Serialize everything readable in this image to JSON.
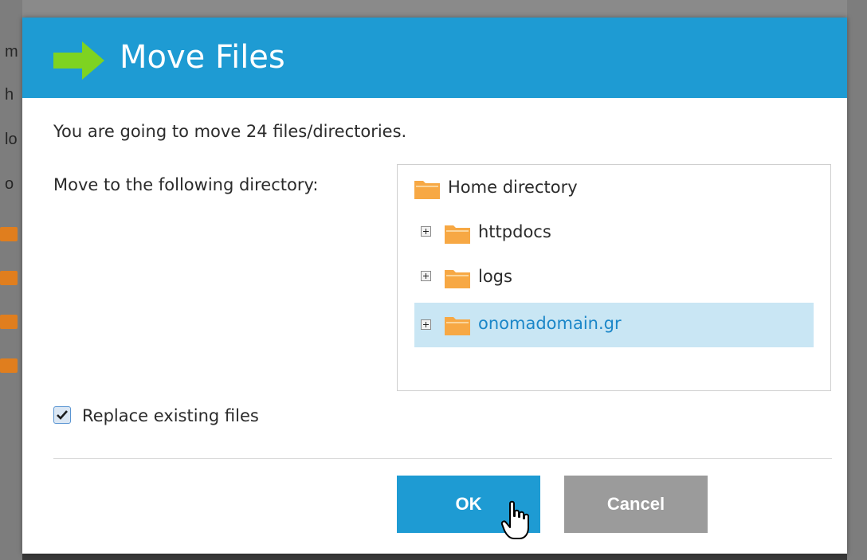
{
  "dialog": {
    "title": "Move Files",
    "message": "You are going to move 24 files/directories.",
    "destination_label": "Move to the following directory:",
    "tree": {
      "root": "Home directory",
      "items": [
        {
          "label": "httpdocs",
          "selected": false
        },
        {
          "label": "logs",
          "selected": false
        },
        {
          "label": "onomadomain.gr",
          "selected": true
        }
      ]
    },
    "replace_checkbox": {
      "label": "Replace existing files",
      "checked": true
    },
    "buttons": {
      "ok": "OK",
      "cancel": "Cancel"
    }
  },
  "background": {
    "fragments": [
      "m",
      "h",
      "lo",
      "o"
    ]
  },
  "colors": {
    "header": "#1e9bd3",
    "arrow": "#7ed321",
    "folder": "#f7a844",
    "selected_row": "#c9e6f4",
    "selected_text": "#1a86c8",
    "ok_button": "#1e9bd3",
    "cancel_button": "#9b9b9b"
  },
  "icons": {
    "header": "arrow-right-icon",
    "tree": "folder-icon",
    "expand": "plus-box-icon",
    "cursor": "hand-pointer-icon"
  }
}
